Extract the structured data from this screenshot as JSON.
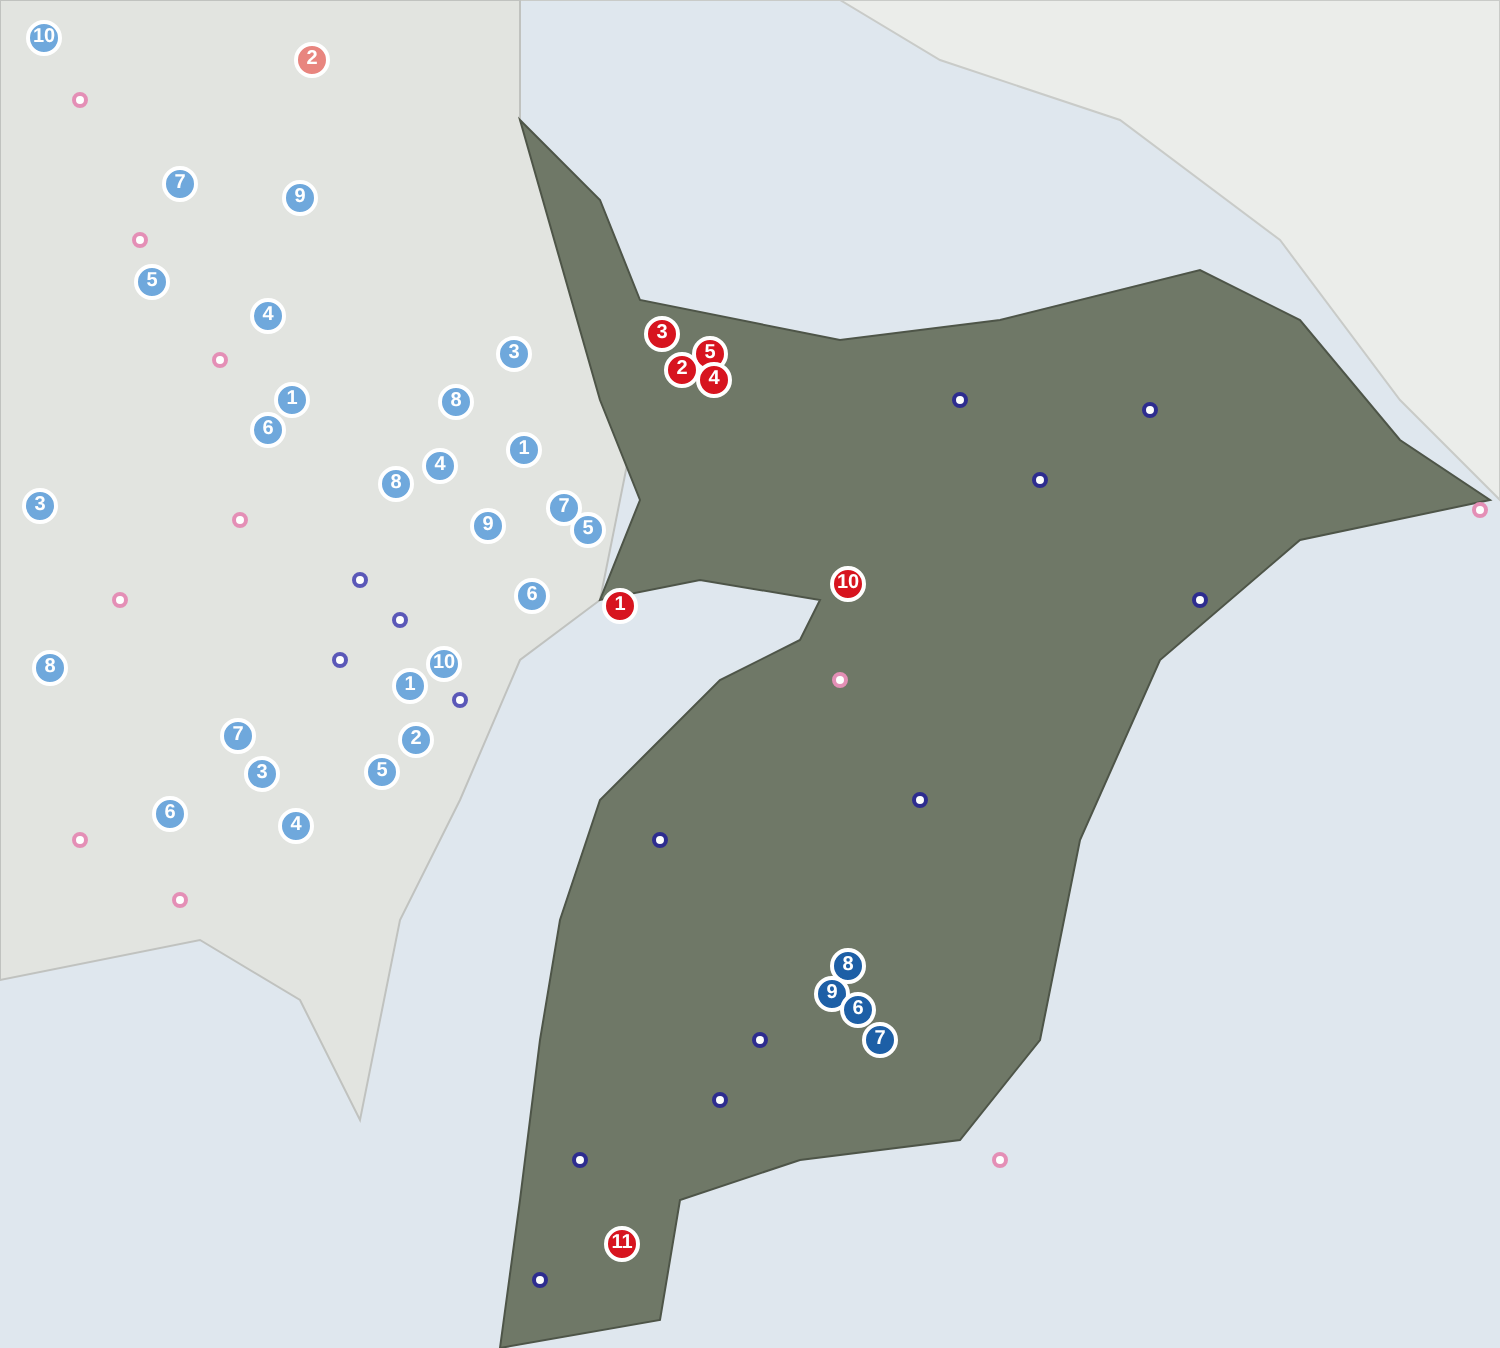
{
  "markers": [
    {
      "label": "10",
      "color": "#6fa8dc"
    },
    {
      "label": "2",
      "color": "#e8857f"
    },
    {
      "label": "7",
      "color": "#6fa8dc"
    },
    {
      "label": "9",
      "color": "#6fa8dc"
    },
    {
      "label": "5",
      "color": "#6fa8dc"
    },
    {
      "label": "4",
      "color": "#6fa8dc"
    },
    {
      "label": "3",
      "color": "#6fa8dc"
    },
    {
      "label": "1",
      "color": "#6fa8dc"
    },
    {
      "label": "8",
      "color": "#6fa8dc"
    },
    {
      "label": "6",
      "color": "#6fa8dc"
    },
    {
      "label": "1",
      "color": "#6fa8dc"
    },
    {
      "label": "4",
      "color": "#6fa8dc"
    },
    {
      "label": "8",
      "color": "#6fa8dc"
    },
    {
      "label": "7",
      "color": "#6fa8dc"
    },
    {
      "label": "9",
      "color": "#6fa8dc"
    },
    {
      "label": "5",
      "color": "#6fa8dc"
    },
    {
      "label": "3",
      "color": "#6fa8dc"
    },
    {
      "label": "6",
      "color": "#6fa8dc"
    },
    {
      "label": "10",
      "color": "#6fa8dc"
    },
    {
      "label": "1",
      "color": "#6fa8dc"
    },
    {
      "label": "8",
      "color": "#6fa8dc"
    },
    {
      "label": "7",
      "color": "#6fa8dc"
    },
    {
      "label": "2",
      "color": "#6fa8dc"
    },
    {
      "label": "3",
      "color": "#6fa8dc"
    },
    {
      "label": "5",
      "color": "#6fa8dc"
    },
    {
      "label": "4",
      "color": "#6fa8dc"
    },
    {
      "label": "6",
      "color": "#6fa8dc"
    },
    {
      "label": "3",
      "color": "#d7141f"
    },
    {
      "label": "5",
      "color": "#d7141f"
    },
    {
      "label": "2",
      "color": "#d7141f"
    },
    {
      "label": "4",
      "color": "#d7141f"
    },
    {
      "label": "1",
      "color": "#d7141f"
    },
    {
      "label": "10",
      "color": "#d7141f"
    },
    {
      "label": "11",
      "color": "#d7141f"
    },
    {
      "label": "8",
      "color": "#1d5fa6"
    },
    {
      "label": "9",
      "color": "#1d5fa6"
    },
    {
      "label": "6",
      "color": "#1d5fa6"
    },
    {
      "label": "7",
      "color": "#1d5fa6"
    }
  ]
}
